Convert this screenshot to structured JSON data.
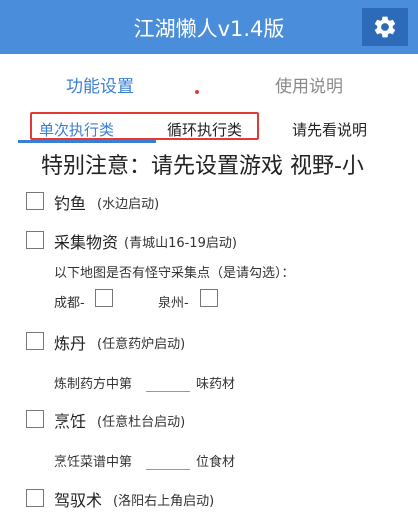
{
  "app": {
    "title": "江湖懒人v1.4版",
    "icon": "gear-icon"
  },
  "tabs": {
    "func": "功能设置",
    "help": "使用说明"
  },
  "subtabs": {
    "single": "单次执行类",
    "loop": "循环执行类",
    "readme": "请先看说明"
  },
  "notice": "特别注意：请先设置游戏 视野-小",
  "options": {
    "fishing": {
      "label": "钓鱼",
      "note": "(水边启动)"
    },
    "gather": {
      "label": "采集物资",
      "note": "(青城山16-19启动)"
    },
    "gather_prompt": "以下地图是否有怪守采集点（是请勾选）：",
    "map_chengdu": "成都-",
    "map_quanzhou": "泉州-",
    "alchemy": {
      "label": "炼丹",
      "note": "(任意药炉启动)"
    },
    "alchemy_prefix": "炼制药方中第",
    "alchemy_suffix": "味药材",
    "cooking": {
      "label": "烹饪",
      "note": "(任意杜台启动)"
    },
    "cooking_prefix": "烹饪菜谱中第",
    "cooking_suffix": "位食材",
    "riding": {
      "label": "驾驭术",
      "note": "(洛阳右上角启动)"
    }
  }
}
